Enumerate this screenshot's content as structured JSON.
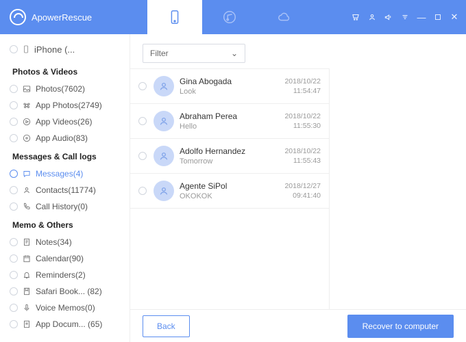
{
  "brand": {
    "name": "ApowerRescue"
  },
  "device": {
    "label": "iPhone (..."
  },
  "sidebar": {
    "section_photos": "Photos & Videos",
    "section_messages": "Messages & Call logs",
    "section_memo": "Memo & Others",
    "items": {
      "photos": "Photos(7602)",
      "app_photos": "App Photos(2749)",
      "app_videos": "App Videos(26)",
      "app_audio": "App Audio(83)",
      "messages": "Messages(4)",
      "contacts": "Contacts(11774)",
      "call_history": "Call History(0)",
      "notes": "Notes(34)",
      "calendar": "Calendar(90)",
      "reminders": "Reminders(2)",
      "safari": "Safari Book... (82)",
      "voice_memos": "Voice Memos(0)",
      "app_docs": "App Docum... (65)"
    }
  },
  "filter": {
    "label": "Filter"
  },
  "threads": [
    {
      "name": "Gina Abogada",
      "preview": "Look",
      "date": "2018/10/22",
      "time": "11:54:47"
    },
    {
      "name": "Abraham Perea",
      "preview": "Hello",
      "date": "2018/10/22",
      "time": "11:55:30"
    },
    {
      "name": "Adolfo Hernandez",
      "preview": "Tomorrow",
      "date": "2018/10/22",
      "time": "11:55:43"
    },
    {
      "name": "Agente SiPol",
      "preview": "OKOKOK",
      "date": "2018/12/27",
      "time": "09:41:40"
    }
  ],
  "buttons": {
    "back": "Back",
    "recover": "Recover to computer"
  }
}
